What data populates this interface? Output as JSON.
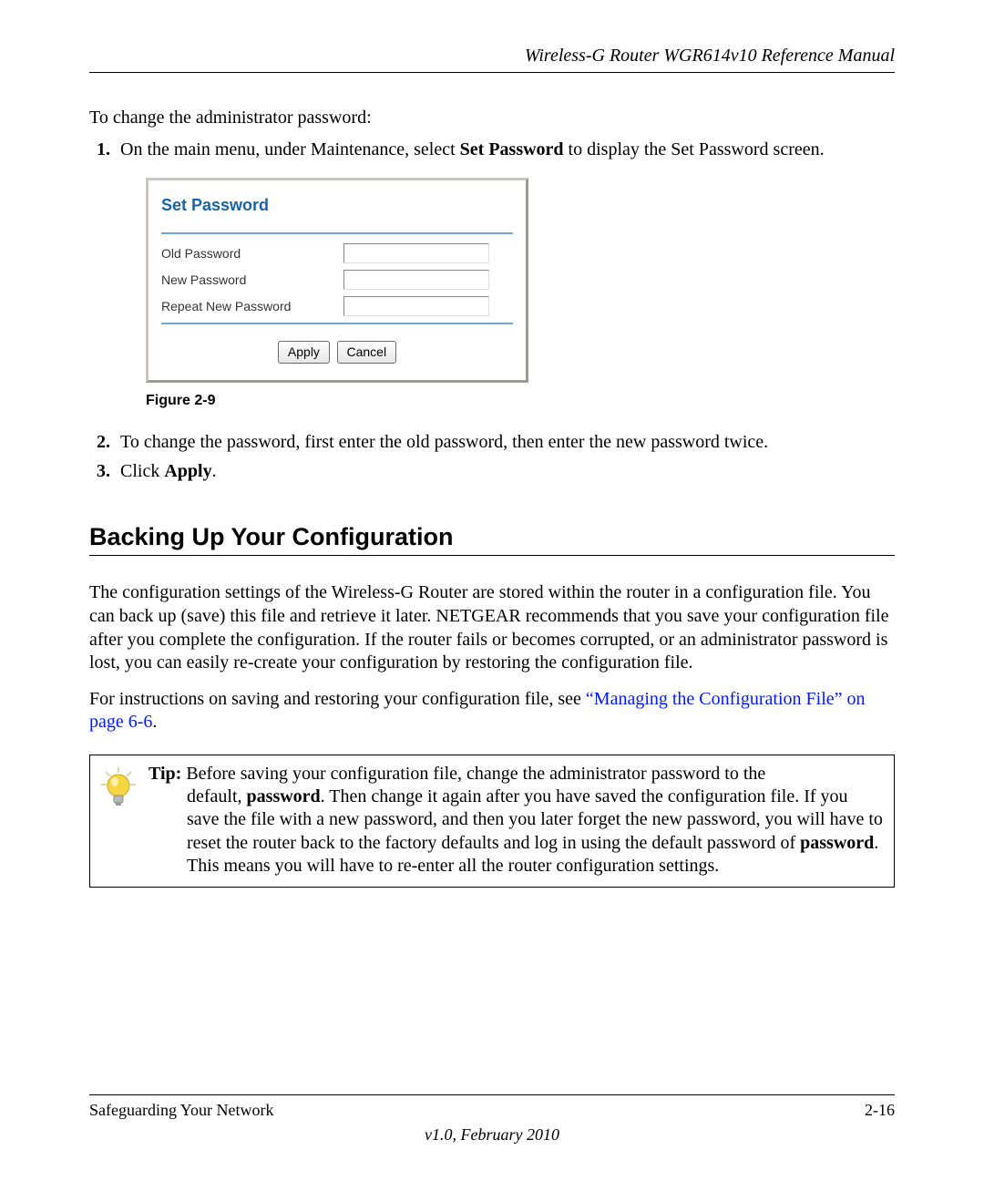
{
  "header": {
    "title": "Wireless-G Router WGR614v10 Reference Manual"
  },
  "intro": "To change the administrator password:",
  "steps": {
    "s1_pre": "On the main menu, under Maintenance, select ",
    "s1_bold": "Set Password",
    "s1_post": " to display the Set Password screen.",
    "s2": "To change the password, first enter the old password, then enter the new password twice.",
    "s3_pre": "Click ",
    "s3_bold": "Apply",
    "s3_post": "."
  },
  "dialog": {
    "title": "Set Password",
    "rows": {
      "old": "Old Password",
      "new": "New Password",
      "repeat": "Repeat New Password"
    },
    "buttons": {
      "apply": "Apply",
      "cancel": "Cancel"
    }
  },
  "figcaption": "Figure 2-9",
  "section_heading": "Backing Up Your Configuration",
  "para1": "The configuration settings of the Wireless-G Router are stored within the router in a configuration file. You can back up (save) this file and retrieve it later. NETGEAR recommends that you save your configuration file after you complete the configuration. If the router fails or becomes corrupted, or an administrator password is lost, you can easily re-create your configuration by restoring the configuration file.",
  "para2_pre": "For instructions on saving and restoring your configuration file, see ",
  "para2_link": "“Managing the Configuration File” on page 6-6",
  "para2_post": ".",
  "tip": {
    "label": "Tip:",
    "l1": " Before saving your configuration file, change the administrator password to the ",
    "l2a": "default, ",
    "l2bold": "password",
    "l2b": ". Then change it again after you have saved the configuration file. If you save the file with a new password, and then you later forget the new password, you will have to reset the router back to the factory defaults and log in using the default password of ",
    "l3bold": "password",
    "l3b": ". This means you will have to re-enter all the router configuration settings."
  },
  "footer": {
    "left": "Safeguarding Your Network",
    "right": "2-16",
    "version": "v1.0, February 2010"
  }
}
